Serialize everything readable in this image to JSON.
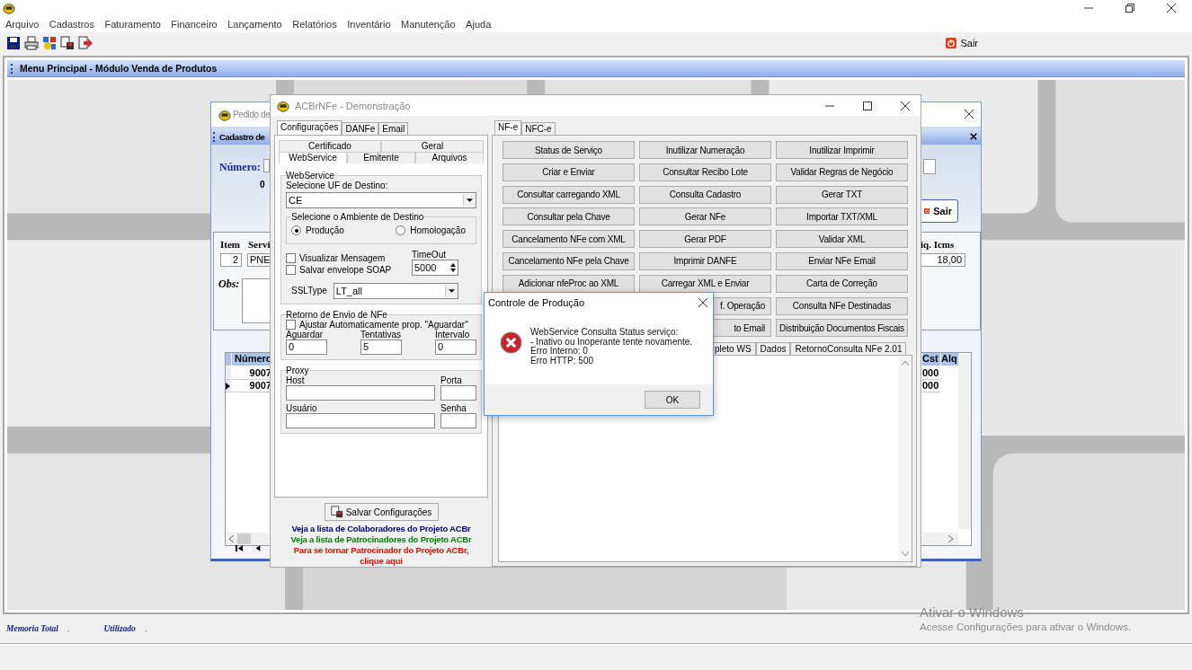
{
  "app": {
    "menu": [
      "Arquivo",
      "Cadastros",
      "Faturamento",
      "Financeiro",
      "Lançamento",
      "Relatórios",
      "Inventário",
      "Manutenção",
      "Ajuda"
    ],
    "exit_button": "Sair"
  },
  "main_header": "Menu Principal - Módulo Venda de Produtos",
  "order_window": {
    "title": "Pedido de",
    "subtitle": "Cadastro de",
    "number_label": "Número:",
    "number_fragment": "0",
    "exit_button": "Sair",
    "item_columns": [
      "Item",
      "Servi"
    ],
    "item_values": [
      "2",
      "PNE"
    ],
    "icms_column": "iq. Icms",
    "icms_value": "18,00",
    "obs_label": "Obs:",
    "grid": {
      "column": "Número",
      "right_columns": [
        "Cst",
        "Alq"
      ],
      "rows": [
        {
          "number": "9007",
          "cst": "000",
          "selected": false
        },
        {
          "number": "9007",
          "cst": "000",
          "selected": true
        }
      ]
    }
  },
  "acbr_window": {
    "title": "ACBrNFe - Demonstração",
    "tabs": [
      {
        "label": "Configurações",
        "selected": true
      },
      {
        "label": "DANFe",
        "selected": false
      },
      {
        "label": "Email",
        "selected": false
      }
    ],
    "subtab_rows": [
      [
        {
          "label": "Certificado",
          "selected": false
        },
        {
          "label": "Geral",
          "selected": false
        }
      ],
      [
        {
          "label": "WebService",
          "selected": true
        },
        {
          "label": "Emitente",
          "selected": false
        },
        {
          "label": "Arquivos",
          "selected": false
        }
      ]
    ],
    "webservice": {
      "title": "WebService",
      "uf_label": "Selecione UF de Destino:",
      "uf_value": "CE",
      "environment": {
        "title": "Selecione o Ambiente de Destino",
        "options": [
          {
            "label": "Produção",
            "selected": true
          },
          {
            "label": "Homologação",
            "selected": false
          }
        ]
      },
      "options": [
        {
          "label": "Visualizar Mensagem",
          "checked": false
        },
        {
          "label": "Salvar envelope SOAP",
          "checked": false
        }
      ],
      "timeout_label": "TimeOut",
      "timeout_value": "5000",
      "ssl_label": "SSLType",
      "ssl_value": "LT_all"
    },
    "return": {
      "title": "Retorno de Envio de NFe",
      "auto_adjust": {
        "label": "Ajustar Automaticamente prop. \"Aguardar\"",
        "checked": false
      },
      "fields": [
        {
          "label": "Aguardar",
          "value": "0"
        },
        {
          "label": "Tentativas",
          "value": "5"
        },
        {
          "label": "Intervalo",
          "value": "0"
        }
      ]
    },
    "proxy": {
      "title": "Proxy",
      "fields": [
        {
          "label": "Host"
        },
        {
          "label": "Porta"
        },
        {
          "label": "Usuário"
        },
        {
          "label": "Senha"
        }
      ]
    },
    "save_button": "Salvar Configurações",
    "links": [
      {
        "text": "Veja a lista de Colaboradores do Projeto ACBr",
        "color": "#000080"
      },
      {
        "text": "Veja a lista de Patrocinadores do Projeto ACBr",
        "color": "#008000"
      },
      {
        "text": "Para se tornar Patrocinador do Projeto ACBr, clique aqui",
        "color": "#ff0000"
      }
    ],
    "nfe_tabs": [
      {
        "label": "NF-e",
        "selected": true
      },
      {
        "label": "NFC-e",
        "selected": false
      }
    ],
    "action_columns": [
      [
        {
          "label": "Status de Serviço",
          "kind": "full"
        },
        {
          "label": "Criar e Enviar",
          "kind": "full"
        },
        {
          "label": "Consultar carregando XML",
          "kind": "full"
        },
        {
          "label": "Consultar pela Chave",
          "kind": "full"
        },
        {
          "label": "Cancelamento NFe com XML",
          "kind": "full"
        },
        {
          "label": "Cancelamento NFe pela Chave",
          "kind": "full"
        },
        {
          "label": "Adicionar nfeProc ao XML",
          "kind": "full"
        }
      ],
      [
        {
          "label": "Inutilizar Numeração",
          "kind": "full"
        },
        {
          "label": "Consultar Recibo Lote",
          "kind": "full"
        },
        {
          "label": "Consulta Cadastro",
          "kind": "full"
        },
        {
          "label": "Gerar NFe",
          "kind": "full"
        },
        {
          "label": "Gerar PDF",
          "kind": "full"
        },
        {
          "label": "Imprimir DANFE",
          "kind": "full"
        },
        {
          "label": "Carregar XML e Enviar",
          "kind": "full"
        },
        {
          "label": "f. Operação",
          "kind": "partial"
        },
        {
          "label": "to Email",
          "kind": "partial"
        }
      ],
      [
        {
          "label": "Inutilizar Imprimir",
          "kind": "full"
        },
        {
          "label": "Validar Regras de Negócio",
          "kind": "full"
        },
        {
          "label": "Gerar TXT",
          "kind": "full"
        },
        {
          "label": "Importar TXT/XML",
          "kind": "full"
        },
        {
          "label": "Validar XML",
          "kind": "full"
        },
        {
          "label": "Enviar NFe Email",
          "kind": "full"
        },
        {
          "label": "Carta de Correção",
          "kind": "full"
        },
        {
          "label": "Consulta NFe Destinadas",
          "kind": "full"
        },
        {
          "label": "Distribuição Documentos Fiscais",
          "kind": "full"
        }
      ]
    ],
    "result_tabs": [
      {
        "label": "pleto WS"
      },
      {
        "label": "Dados"
      },
      {
        "label": "RetornoConsulta NFe 2.01"
      }
    ]
  },
  "dialog": {
    "title": "Controle de Produção",
    "message": [
      "WebService Consulta Status serviço:",
      "- Inativo ou Inoperante tente novamente.",
      "Erro Interno: 0",
      "Erro HTTP: 500"
    ],
    "button": "OK"
  },
  "status_bar": {
    "memory": [
      {
        "label": "Memoria Total",
        "value": "."
      },
      {
        "label": "Utilizado",
        "value": "."
      }
    ]
  },
  "windows_notice": {
    "title": "Ativar o Windows",
    "text": "Acesse Configurações para ativar o Windows."
  }
}
